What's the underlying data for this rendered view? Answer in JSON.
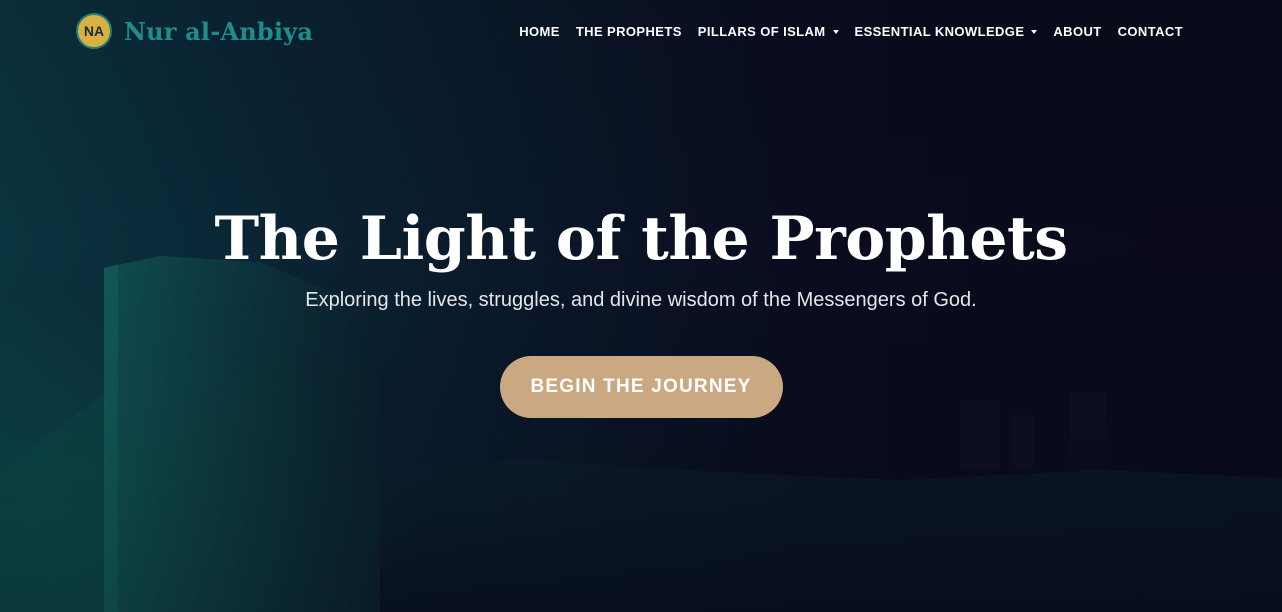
{
  "brand": {
    "badge_text": "NA",
    "name": "Nur al-Anbiya"
  },
  "nav": {
    "items": [
      {
        "label": "HOME",
        "has_dropdown": false
      },
      {
        "label": "THE PROPHETS",
        "has_dropdown": false
      },
      {
        "label": "PILLARS OF ISLAM",
        "has_dropdown": true
      },
      {
        "label": "ESSENTIAL KNOWLEDGE",
        "has_dropdown": true
      },
      {
        "label": "ABOUT",
        "has_dropdown": false
      },
      {
        "label": "CONTACT",
        "has_dropdown": false
      }
    ]
  },
  "hero": {
    "title": "The Light of the Prophets",
    "subtitle": "Exploring the lives, struggles, and divine wisdom of the Messengers of God.",
    "cta_label": "BEGIN THE JOURNEY"
  },
  "colors": {
    "brand_teal": "#1f8e8a",
    "badge_gold": "#d8b13e",
    "cta_tan": "#c9a882",
    "background_dark": "#0a0b1a"
  }
}
